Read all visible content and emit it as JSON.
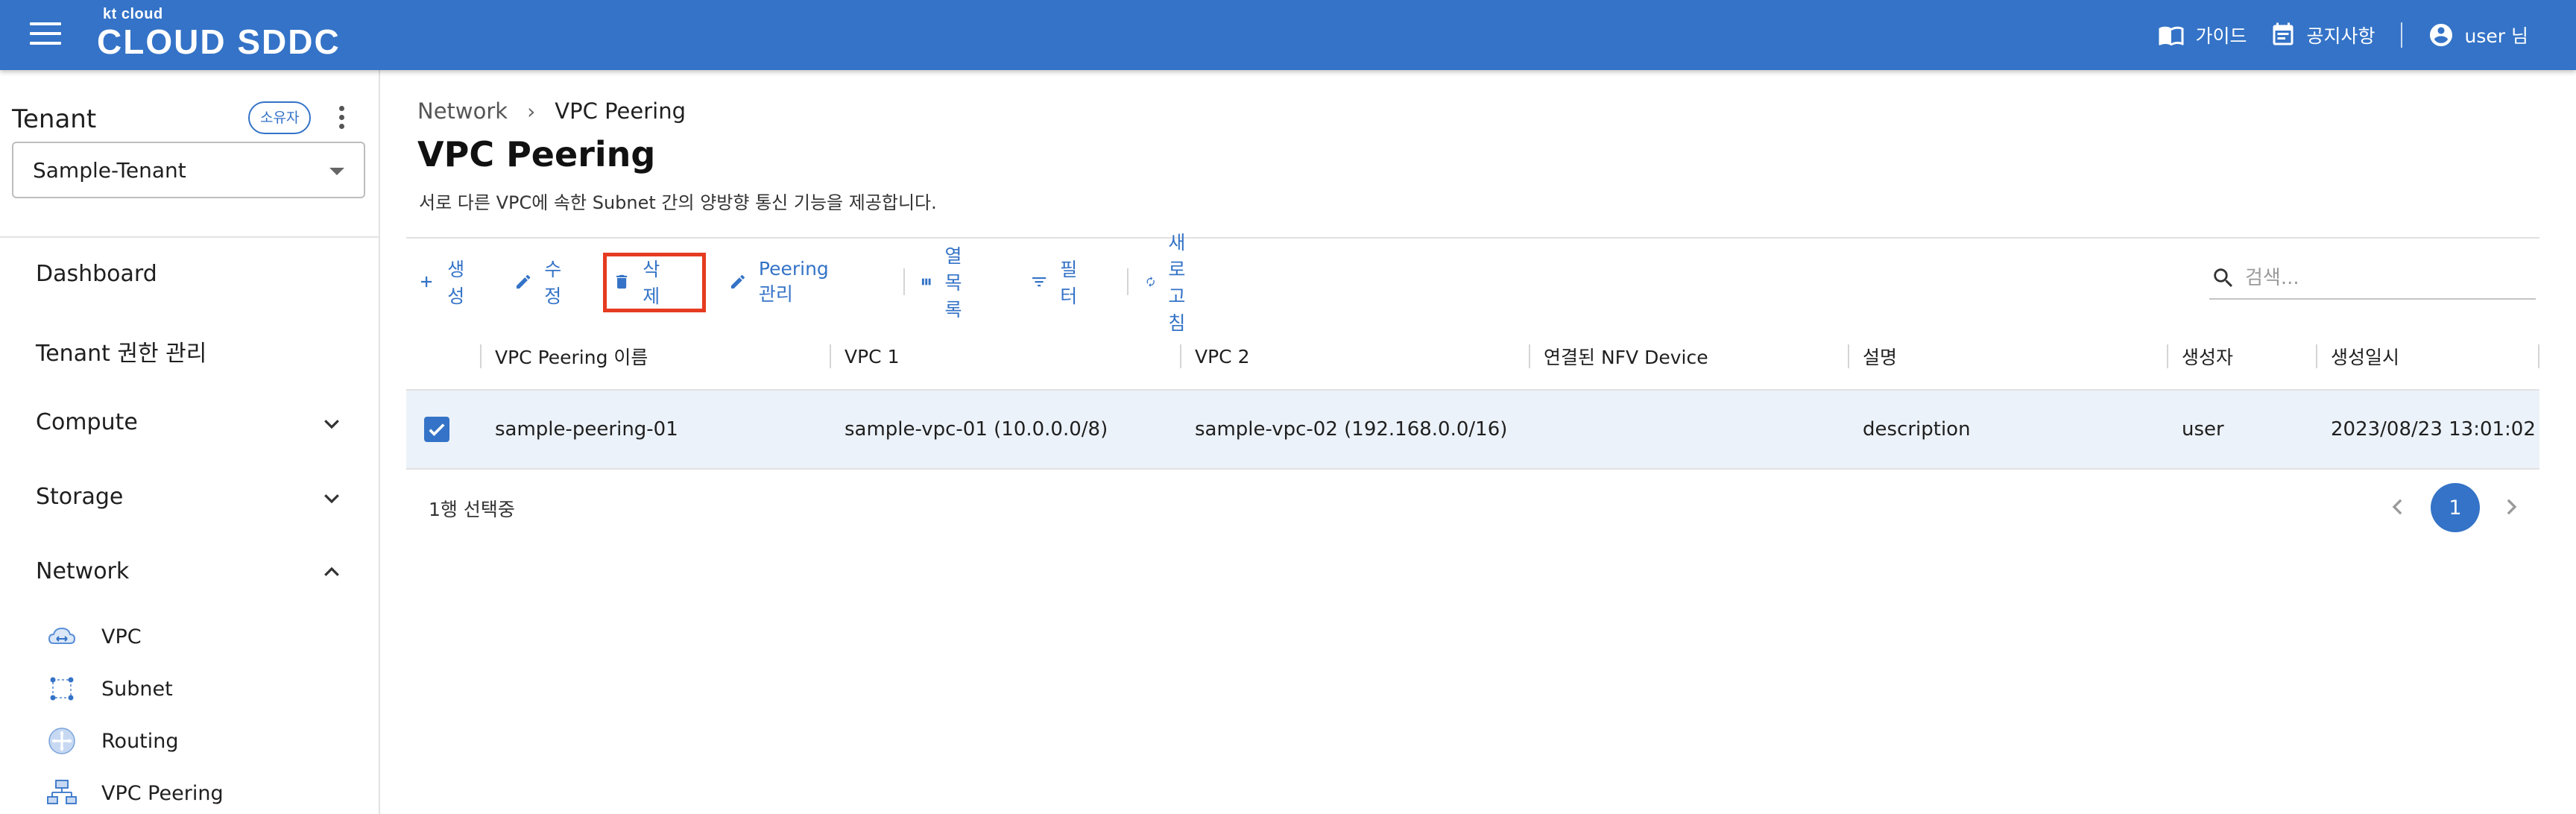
{
  "header": {
    "logo_small": "kt cloud",
    "logo_main": "CLOUD SDDC",
    "guide_label": "가이드",
    "notice_label": "공지사항",
    "user_label": "user 님",
    "bg_color": "#3473c7"
  },
  "sidebar": {
    "tenant_title": "Tenant",
    "owner_badge": "소유자",
    "tenant_selected": "Sample-Tenant",
    "menu": {
      "dashboard": "Dashboard",
      "tenant_auth": "Tenant 권한 관리",
      "compute": "Compute",
      "storage": "Storage",
      "network": "Network"
    },
    "network_items": [
      {
        "label": "VPC",
        "icon": "vpc-cloud-icon"
      },
      {
        "label": "Subnet",
        "icon": "subnet-icon"
      },
      {
        "label": "Routing",
        "icon": "routing-icon"
      },
      {
        "label": "VPC Peering",
        "icon": "vpc-peering-icon"
      }
    ]
  },
  "breadcrumb": {
    "parent": "Network",
    "current": "VPC Peering"
  },
  "page": {
    "title": "VPC Peering",
    "description": "서로 다른 VPC에 속한 Subnet 간의 양방향 통신 기능을 제공합니다."
  },
  "toolbar": {
    "create": "생성",
    "edit": "수정",
    "delete": "삭제",
    "peering_manage": "Peering 관리",
    "columns": "열 목록",
    "filter": "필터",
    "refresh": "새로고침",
    "search_placeholder": "검색..."
  },
  "table": {
    "columns": [
      "VPC Peering 이름",
      "VPC 1",
      "VPC 2",
      "연결된 NFV Device",
      "설명",
      "생성자",
      "생성일시"
    ],
    "rows": [
      {
        "selected": true,
        "name": "sample-peering-01",
        "vpc1": "sample-vpc-01 (10.0.0.0/8)",
        "vpc2": "sample-vpc-02 (192.168.0.0/16)",
        "nfv_device": "",
        "description": "description",
        "creator": "user",
        "created_at": "2023/08/23 13:01:02"
      }
    ]
  },
  "footer": {
    "selection_status": "1행 선택중",
    "current_page": "1"
  },
  "colors": {
    "accent": "#3473c7",
    "highlight_outline": "#e53b20",
    "selected_row": "#ecf2f9"
  }
}
